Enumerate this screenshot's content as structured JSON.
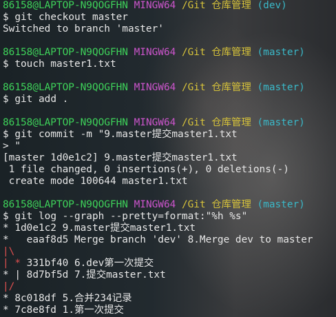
{
  "prompt": {
    "user_host": "86158@LAPTOP-N9QOGFHN",
    "shell": "MINGW64",
    "path": "/Git 仓库管理",
    "branch_dev": "(dev)",
    "branch_master": "(master)",
    "dollar": "$"
  },
  "commands": {
    "checkout": "git checkout master",
    "touch": "touch master1.txt",
    "add": "git add .",
    "commit": "git commit -m \"9.master提交master1.txt",
    "commit_cont_marker": ">",
    "commit_cont_text": " \"",
    "log": "git log --graph --pretty=format:\"%h %s\""
  },
  "output": {
    "switched": "Switched to branch 'master'",
    "commit_result": "[master 1d0e1c2] 9.master提交master1.txt",
    "files_changed": " 1 file changed, 0 insertions(+), 0 deletions(-)",
    "create_mode": " create mode 100644 master1.txt"
  },
  "log_graph": [
    {
      "graph": "* ",
      "hash": "1d0e1c2",
      "message": "9.master提交master1.txt"
    },
    {
      "graph": "*   ",
      "hash": "eaaf8d5",
      "message": "Merge branch 'dev' 8.Merge dev to master"
    },
    {
      "graph": "|\\",
      "hash": "",
      "message": ""
    },
    {
      "graph": "| * ",
      "hash": "331bf40",
      "message": "6.dev第一次提交"
    },
    {
      "graph": "* | ",
      "hash": "8d7bf5d",
      "message": "7.提交master.txt"
    },
    {
      "graph": "|/",
      "hash": "",
      "message": ""
    },
    {
      "graph": "* ",
      "hash": "8c018df",
      "message": "5.合并234记录"
    },
    {
      "graph": "* ",
      "hash": "7c8e8fd",
      "message": "1.第一次提交"
    }
  ],
  "colors": {
    "user_host": "#3ed35a",
    "shell": "#cc55cc",
    "path": "#d6c23a",
    "branch": "#3ab8c8",
    "graph_red": "#e05050",
    "text": "#e8e8e8"
  }
}
